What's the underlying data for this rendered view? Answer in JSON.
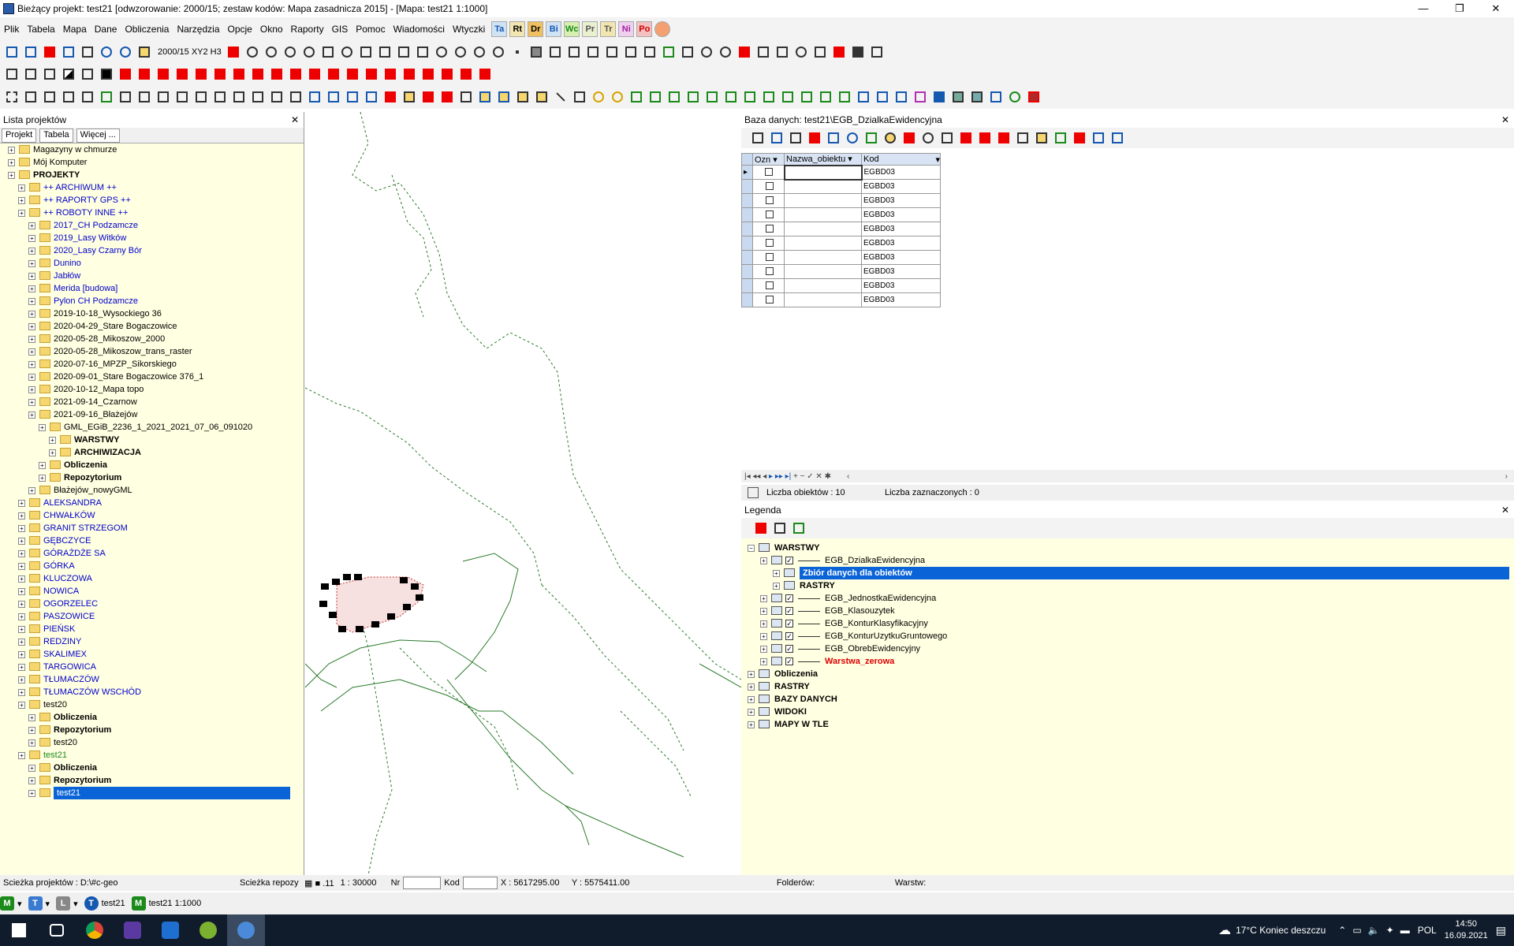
{
  "title": "Bieżący projekt: test21 [odwzorowanie: 2000/15; zestaw kodów: Mapa zasadnicza 2015] - [Mapa: test21  1:1000]",
  "window_buttons": [
    "—",
    "❐",
    "✕"
  ],
  "menu": [
    "Plik",
    "Tabela",
    "Mapa",
    "Dane",
    "Obliczenia",
    "Narzędzia",
    "Opcje",
    "Okno",
    "Raporty",
    "GIS",
    "Pomoc",
    "Wiadomości",
    "Wtyczki"
  ],
  "menu_plugins": [
    "Ta",
    "Rt",
    "Dr",
    "Bi",
    "Wc",
    "Pr",
    "Tr",
    "Ni",
    "Po"
  ],
  "toolbar1_label": "2000/15 XY2 H3",
  "projects_panel": {
    "title": "Lista projektów",
    "tabs": [
      "Projekt",
      "Tabela",
      "Więcej ..."
    ],
    "tree": [
      {
        "label": "Magazyny w chmurze",
        "level": 0,
        "style": ""
      },
      {
        "label": "Mój Komputer",
        "level": 0,
        "style": ""
      },
      {
        "label": "PROJEKTY",
        "level": 0,
        "style": "bold"
      },
      {
        "label": "++ ARCHIWUM ++",
        "level": 1,
        "style": "blue"
      },
      {
        "label": "++ RAPORTY GPS ++",
        "level": 1,
        "style": "blue"
      },
      {
        "label": "++ ROBOTY INNE ++",
        "level": 1,
        "style": "blue"
      },
      {
        "label": "2017_CH Podzamcze",
        "level": 2,
        "style": "blue"
      },
      {
        "label": "2019_Lasy Witków",
        "level": 2,
        "style": "blue"
      },
      {
        "label": "2020_Lasy Czarny Bór",
        "level": 2,
        "style": "blue"
      },
      {
        "label": "Dunino",
        "level": 2,
        "style": "blue"
      },
      {
        "label": "Jabłów",
        "level": 2,
        "style": "blue"
      },
      {
        "label": "Merida [budowa]",
        "level": 2,
        "style": "blue"
      },
      {
        "label": "Pylon CH Podzamcze",
        "level": 2,
        "style": "blue"
      },
      {
        "label": "2019-10-18_Wysockiego 36",
        "level": 2,
        "style": ""
      },
      {
        "label": "2020-04-29_Stare Bogaczowice",
        "level": 2,
        "style": ""
      },
      {
        "label": "2020-05-28_Mikoszow_2000",
        "level": 2,
        "style": ""
      },
      {
        "label": "2020-05-28_Mikoszow_trans_raster",
        "level": 2,
        "style": ""
      },
      {
        "label": "2020-07-16_MPZP_Sikorskiego",
        "level": 2,
        "style": ""
      },
      {
        "label": "2020-09-01_Stare Bogaczowice 376_1",
        "level": 2,
        "style": ""
      },
      {
        "label": "2020-10-12_Mapa topo",
        "level": 2,
        "style": ""
      },
      {
        "label": "2021-09-14_Czarnow",
        "level": 2,
        "style": ""
      },
      {
        "label": "2021-09-16_Błażejów",
        "level": 2,
        "style": ""
      },
      {
        "label": "GML_EGiB_2236_1_2021_2021_07_06_091020",
        "level": 3,
        "style": ""
      },
      {
        "label": "WARSTWY",
        "level": 4,
        "style": "bold"
      },
      {
        "label": "ARCHIWIZACJA",
        "level": 4,
        "style": "bold"
      },
      {
        "label": "Obliczenia",
        "level": 3,
        "style": "bold"
      },
      {
        "label": "Repozytorium",
        "level": 3,
        "style": "bold"
      },
      {
        "label": "Błażejów_nowyGML",
        "level": 2,
        "style": ""
      },
      {
        "label": "ALEKSANDRA",
        "level": 1,
        "style": "blue"
      },
      {
        "label": "CHWAŁKÓW",
        "level": 1,
        "style": "blue"
      },
      {
        "label": "GRANIT STRZEGOM",
        "level": 1,
        "style": "blue"
      },
      {
        "label": "GĘBCZYCE",
        "level": 1,
        "style": "blue"
      },
      {
        "label": "GÓRAŻDŻE SA",
        "level": 1,
        "style": "blue"
      },
      {
        "label": "GÓRKA",
        "level": 1,
        "style": "blue"
      },
      {
        "label": "KLUCZOWA",
        "level": 1,
        "style": "blue"
      },
      {
        "label": "NOWICA",
        "level": 1,
        "style": "blue"
      },
      {
        "label": "OGORZELEC",
        "level": 1,
        "style": "blue"
      },
      {
        "label": "PASZOWICE",
        "level": 1,
        "style": "blue"
      },
      {
        "label": "PIEŃSK",
        "level": 1,
        "style": "blue"
      },
      {
        "label": "REDZINY",
        "level": 1,
        "style": "blue"
      },
      {
        "label": "SKALIMEX",
        "level": 1,
        "style": "blue"
      },
      {
        "label": "TARGOWICA",
        "level": 1,
        "style": "blue"
      },
      {
        "label": "TŁUMACZÓW",
        "level": 1,
        "style": "blue"
      },
      {
        "label": "TŁUMACZÓW WSCHÓD",
        "level": 1,
        "style": "blue"
      },
      {
        "label": "test20",
        "level": 1,
        "style": ""
      },
      {
        "label": "Obliczenia",
        "level": 2,
        "style": "bold"
      },
      {
        "label": "Repozytorium",
        "level": 2,
        "style": "bold"
      },
      {
        "label": "test20",
        "level": 2,
        "style": ""
      },
      {
        "label": "test21",
        "level": 1,
        "style": "green"
      },
      {
        "label": "Obliczenia",
        "level": 2,
        "style": "bold"
      },
      {
        "label": "Repozytorium",
        "level": 2,
        "style": "bold"
      },
      {
        "label": "test21",
        "level": 2,
        "style": "selected"
      }
    ]
  },
  "database_panel": {
    "title": "Baza danych: test21\\EGB_DzialkaEwidencyjna",
    "columns": [
      "Ozn",
      "Nazwa_obiektu",
      "Kod"
    ],
    "rows": [
      "EGBD03",
      "EGBD03",
      "EGBD03",
      "EGBD03",
      "EGBD03",
      "EGBD03",
      "EGBD03",
      "EGBD03",
      "EGBD03",
      "EGBD03"
    ],
    "object_count": "Liczba obiektów : 10",
    "selected_count": "Liczba zaznaczonych : 0"
  },
  "legend_panel": {
    "title": "Legenda",
    "items": [
      {
        "label": "WARSTWY",
        "level": 0,
        "style": "bold"
      },
      {
        "label": "EGB_DzialkaEwidencyjna",
        "level": 1,
        "style": "layer"
      },
      {
        "label": "Zbiór danych dla obiektów",
        "level": 2,
        "style": "selected"
      },
      {
        "label": "RASTRY",
        "level": 2,
        "style": "bold"
      },
      {
        "label": "EGB_JednostkaEwidencyjna",
        "level": 1,
        "style": "layer"
      },
      {
        "label": "EGB_Klasouzytek",
        "level": 1,
        "style": "layer"
      },
      {
        "label": "EGB_KonturKlasyfikacyjny",
        "level": 1,
        "style": "layer"
      },
      {
        "label": "EGB_KonturUzytkuGruntowego",
        "level": 1,
        "style": "layer"
      },
      {
        "label": "EGB_ObrebEwidencyjny",
        "level": 1,
        "style": "layer"
      },
      {
        "label": "Warstwa_zerowa",
        "level": 1,
        "style": "red"
      },
      {
        "label": "Obliczenia",
        "level": 0,
        "style": "bold"
      },
      {
        "label": "RASTRY",
        "level": 0,
        "style": "bold"
      },
      {
        "label": "BAZY DANYCH",
        "level": 0,
        "style": "bold"
      },
      {
        "label": "WIDOKI",
        "level": 0,
        "style": "bold"
      },
      {
        "label": "MAPY W TLE",
        "level": 0,
        "style": "bold"
      }
    ]
  },
  "status": {
    "path": "Scieżka projektów : D:\\#c-geo",
    "repo": "Scieżka repozy",
    "scale": "1 : 30000",
    "nr_label": "Nr",
    "kod_label": "Kod",
    "x": "X : 5617295.00",
    "y": "Y : 5575411.00",
    "folders": "Folderów:",
    "layers": "Warstw:"
  },
  "window_tabs": [
    {
      "icon": "T",
      "label": "test21",
      "color": "#1558b0"
    },
    {
      "icon": "M",
      "label": "test21  1:1000",
      "color": "#1a8a1a"
    }
  ],
  "taskbar": {
    "weather": "17°C  Koniec deszczu",
    "lang": "POL",
    "time": "14:50",
    "date": "16.09.2021"
  }
}
